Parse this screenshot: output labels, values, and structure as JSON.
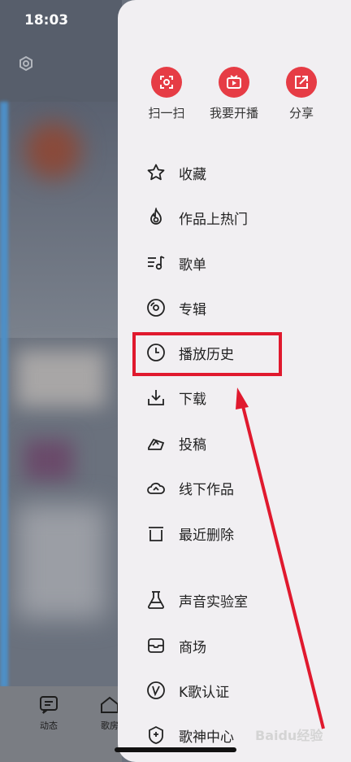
{
  "status": {
    "time": "18:03"
  },
  "tabbar": {
    "tab1": "动态",
    "tab2": "歌房"
  },
  "quick_actions": [
    {
      "label": "扫一扫",
      "icon": "scan-icon"
    },
    {
      "label": "我要开播",
      "icon": "live-broadcast-icon"
    },
    {
      "label": "分享",
      "icon": "share-icon"
    }
  ],
  "menu": [
    {
      "label": "收藏",
      "icon": "star-icon"
    },
    {
      "label": "作品上热门",
      "icon": "flame-icon"
    },
    {
      "label": "歌单",
      "icon": "playlist-icon"
    },
    {
      "label": "专辑",
      "icon": "album-icon"
    },
    {
      "label": "播放历史",
      "icon": "clock-icon"
    },
    {
      "label": "下载",
      "icon": "download-icon"
    },
    {
      "label": "投稿",
      "icon": "contribute-icon"
    },
    {
      "label": "线下作品",
      "icon": "cloud-icon"
    },
    {
      "label": "最近删除",
      "icon": "trash-icon"
    },
    {
      "label": "声音实验室",
      "icon": "flask-icon"
    },
    {
      "label": "商场",
      "icon": "store-icon"
    },
    {
      "label": "K歌认证",
      "icon": "verified-icon"
    },
    {
      "label": "歌神中心",
      "icon": "badge-icon"
    }
  ],
  "annotation": {
    "highlight_color": "#e0192e"
  },
  "colors": {
    "accent": "#e63c45",
    "drawer_bg": "#f1eff2"
  },
  "watermark": "Baidu经验"
}
